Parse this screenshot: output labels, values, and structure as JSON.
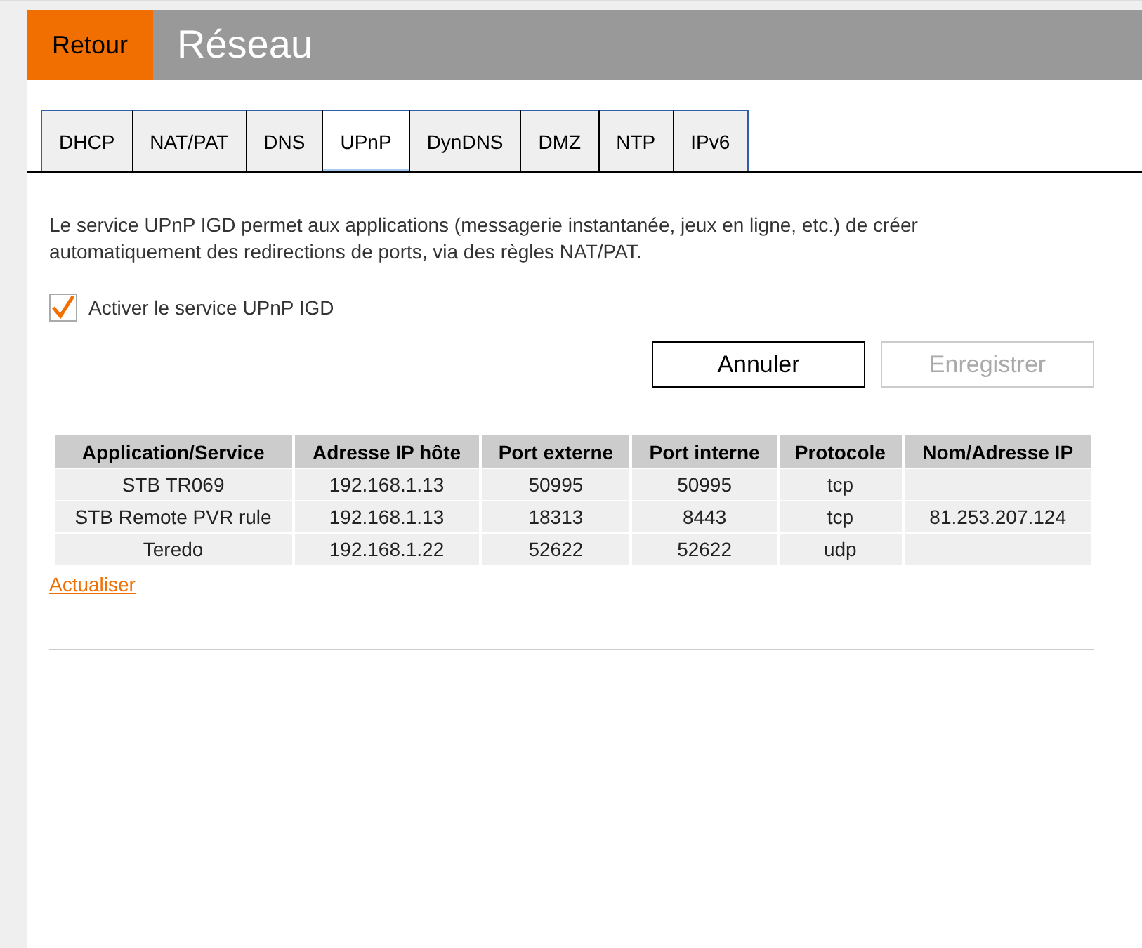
{
  "header": {
    "back_button": "Retour",
    "title": "Réseau"
  },
  "tabs": [
    {
      "label": "DHCP",
      "selected": false
    },
    {
      "label": "NAT/PAT",
      "selected": false
    },
    {
      "label": "DNS",
      "selected": false
    },
    {
      "label": "UPnP",
      "selected": true
    },
    {
      "label": "DynDNS",
      "selected": false
    },
    {
      "label": "DMZ",
      "selected": false
    },
    {
      "label": "NTP",
      "selected": false
    },
    {
      "label": "IPv6",
      "selected": false
    }
  ],
  "description": "Le service UPnP IGD permet aux applications (messagerie instantanée, jeux en ligne, etc.) de créer automatiquement des redirections de ports, via des règles NAT/PAT.",
  "enable_checkbox": {
    "label": "Activer le service UPnP IGD",
    "checked": true
  },
  "buttons": [
    {
      "label": "Annuler",
      "disabled": false
    },
    {
      "label": "Enregistrer",
      "disabled": true
    }
  ],
  "table": {
    "columns": [
      "Application/Service",
      "Adresse IP hôte",
      "Port externe",
      "Port interne",
      "Protocole",
      "Nom/Adresse IP"
    ],
    "rows": [
      {
        "cells": [
          "STB TR069",
          "192.168.1.13",
          "50995",
          "50995",
          "tcp",
          null
        ]
      },
      {
        "cells": [
          "STB Remote PVR rule",
          "192.168.1.13",
          "18313",
          "8443",
          "tcp",
          "81.253.207.124"
        ]
      },
      {
        "cells": [
          "Teredo",
          "192.168.1.22",
          "52622",
          "52622",
          "udp",
          null
        ]
      }
    ]
  },
  "refresh_link": "Actualiser"
}
